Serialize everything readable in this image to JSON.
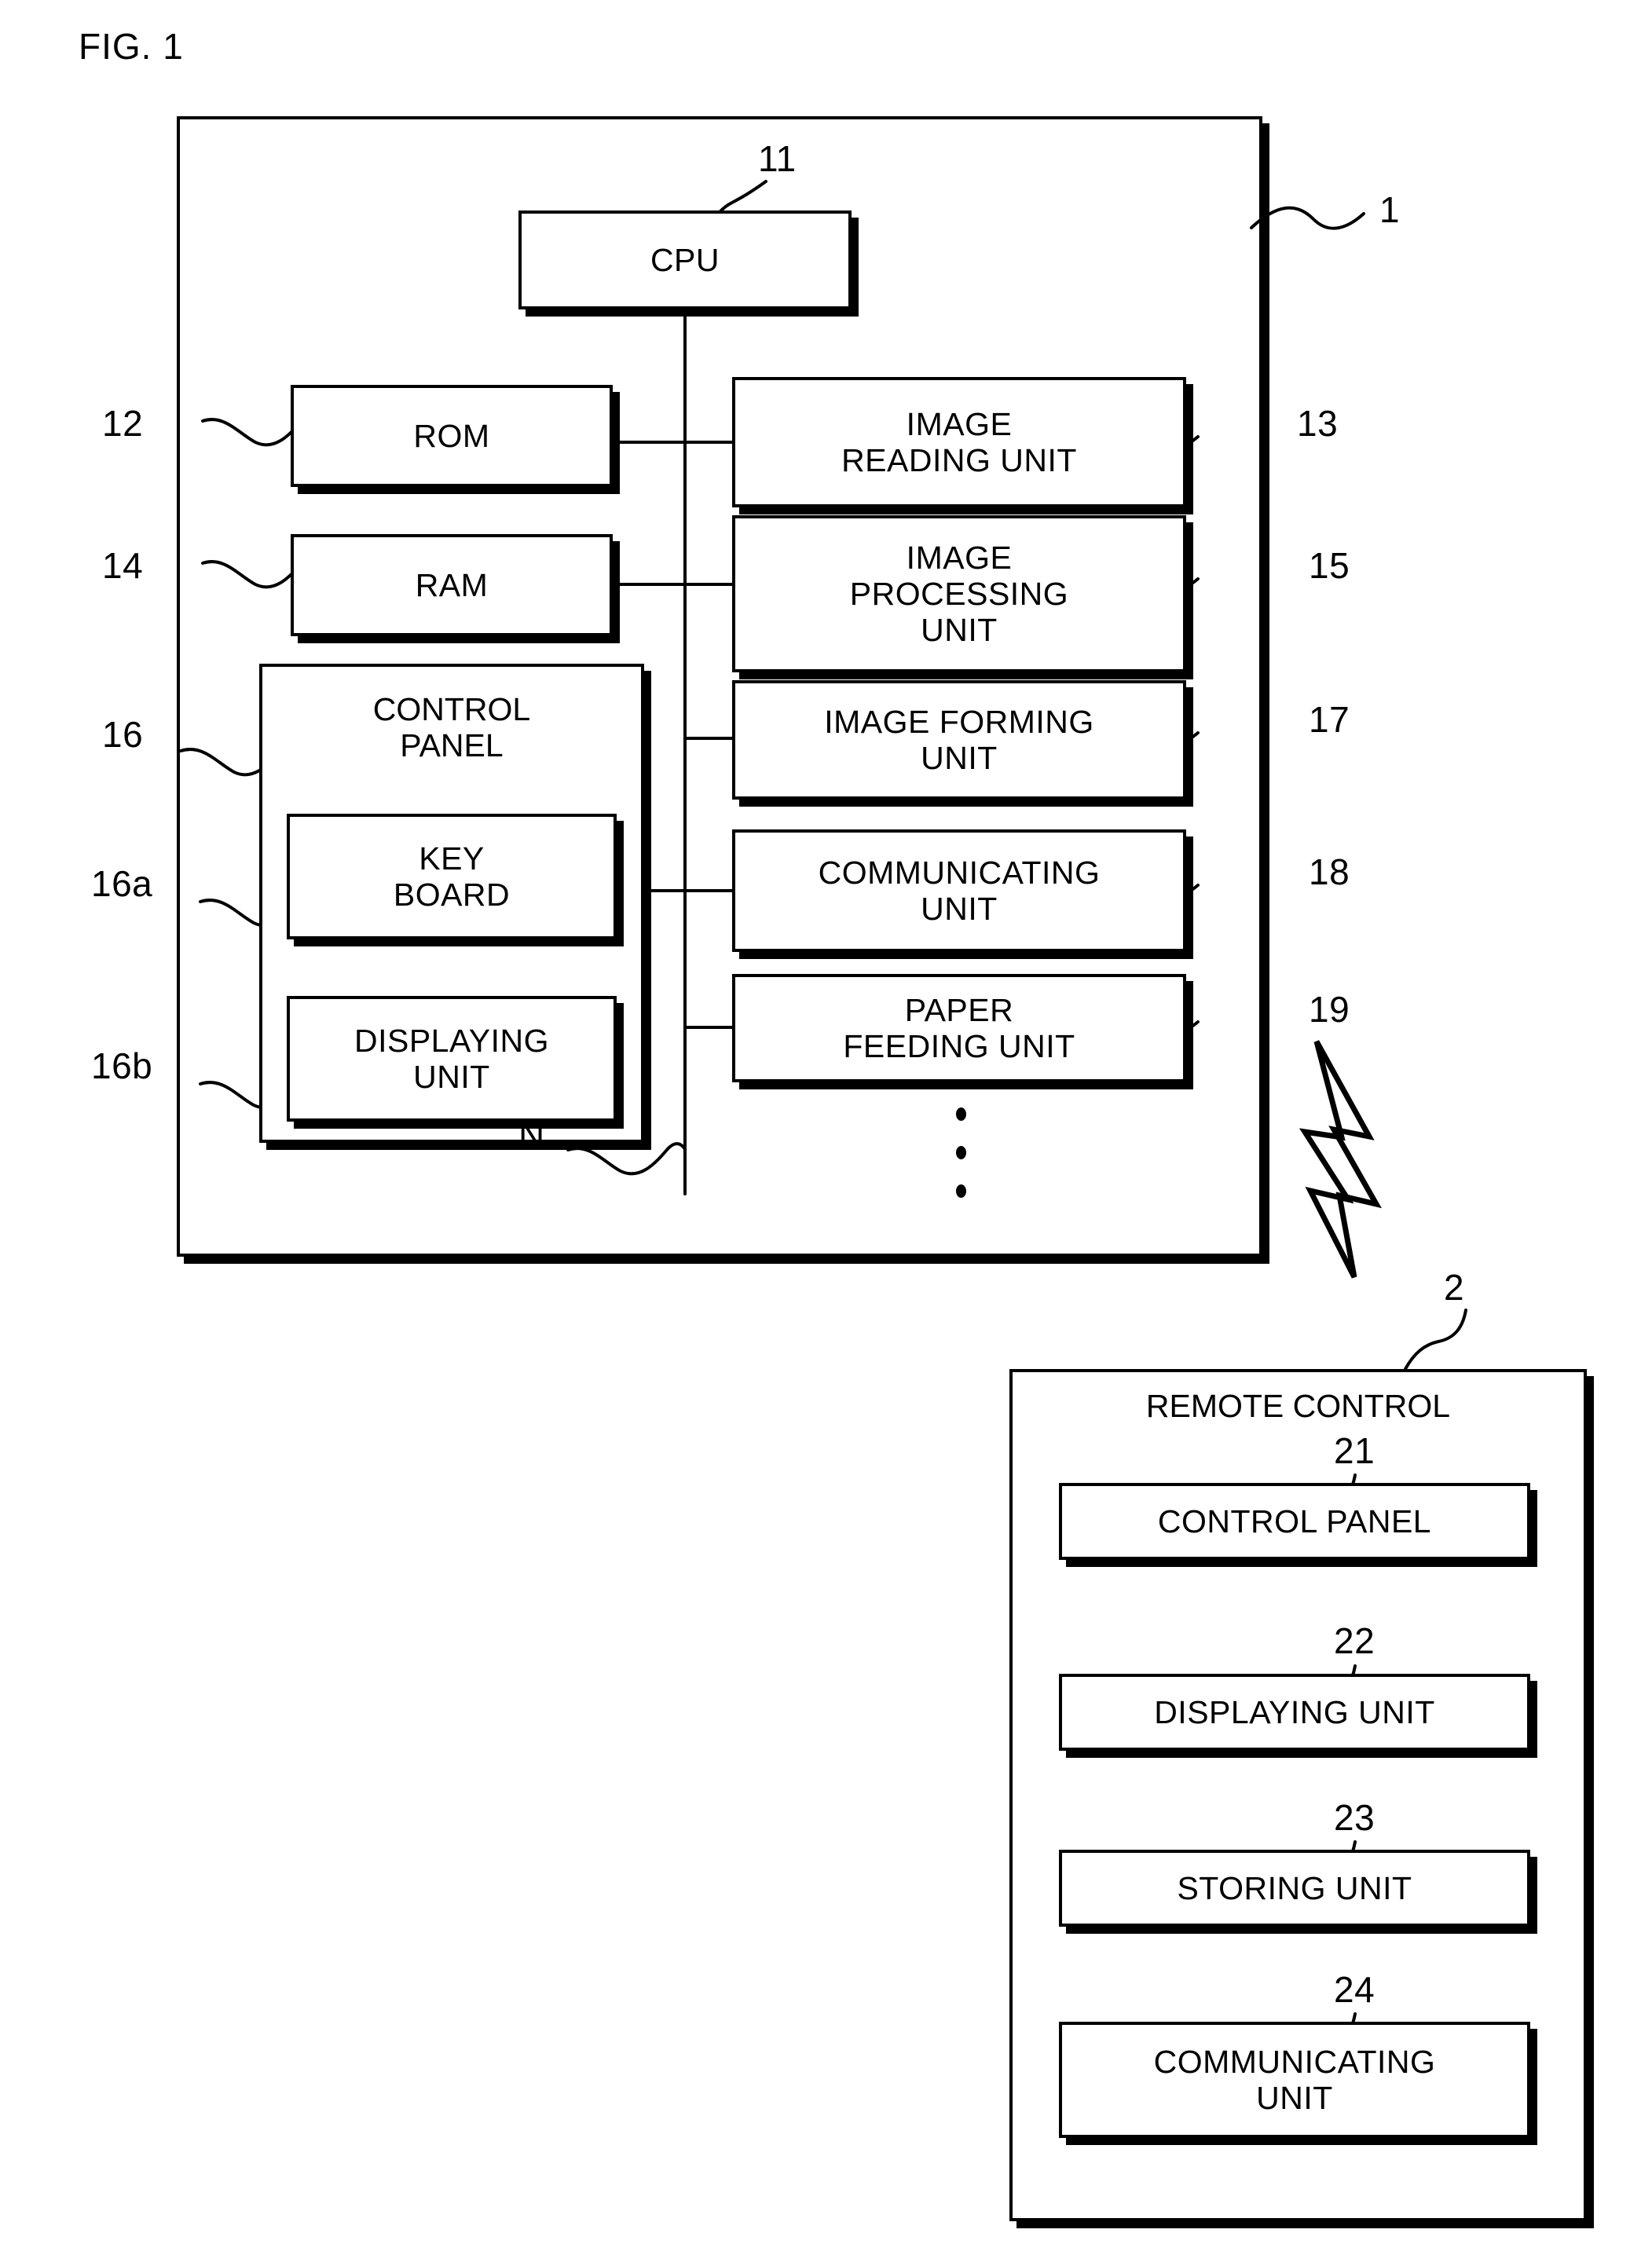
{
  "figure": {
    "title": "FIG. 1"
  },
  "device": {
    "ref": "1",
    "bus_label": "N",
    "cpu": {
      "label": "CPU",
      "ref": "11"
    },
    "rom": {
      "label": "ROM",
      "ref": "12"
    },
    "ram": {
      "label": "RAM",
      "ref": "14"
    },
    "control_panel": {
      "label": "CONTROL\nPANEL",
      "ref": "16",
      "children": [
        {
          "label": "KEY\nBOARD",
          "ref": "16a"
        },
        {
          "label": "DISPLAYING\nUNIT",
          "ref": "16b"
        }
      ]
    },
    "right_units": [
      {
        "label": "IMAGE\nREADING  UNIT",
        "ref": "13"
      },
      {
        "label": "IMAGE\nPROCESSING\nUNIT",
        "ref": "15"
      },
      {
        "label": "IMAGE  FORMING\nUNIT",
        "ref": "17"
      },
      {
        "label": "COMMUNICATING\nUNIT",
        "ref": "18"
      },
      {
        "label": "PAPER\nFEEDING  UNIT",
        "ref": "19"
      }
    ],
    "continuation_dots": "⋮"
  },
  "link": {
    "icon": "lightning-bolt-icon"
  },
  "remote": {
    "ref": "2",
    "title": "REMOTE  CONTROL",
    "units": [
      {
        "label": "CONTROL  PANEL",
        "ref": "21"
      },
      {
        "label": "DISPLAYING  UNIT",
        "ref": "22"
      },
      {
        "label": "STORING  UNIT",
        "ref": "23"
      },
      {
        "label": "COMMUNICATING\nUNIT",
        "ref": "24"
      }
    ]
  },
  "colors": {
    "ink": "#000000",
    "paper": "#ffffff"
  }
}
